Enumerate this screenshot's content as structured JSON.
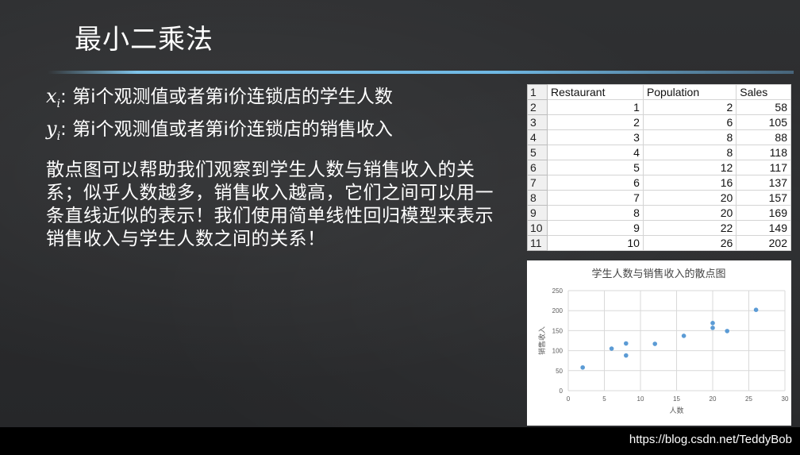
{
  "slide": {
    "title": "最小二乘法",
    "defs": [
      {
        "var": "x",
        "sub": "i",
        "text": ": 第i个观测值或者第i价连锁店的学生人数"
      },
      {
        "var": "y",
        "sub": "i",
        "text": ": 第i个观测值或者第i价连锁店的销售收入"
      }
    ],
    "paragraph": "散点图可以帮助我们观察到学生人数与销售收入的关系；似乎人数越多，销售收入越高，它们之间可以用一条直线近似的表示！我们使用简单线性回归模型来表示销售收入与学生人数之间的关系！",
    "watermark": "https://blog.csdn.net/TeddyBob"
  },
  "table": {
    "row_numbers": [
      "1",
      "2",
      "3",
      "4",
      "5",
      "6",
      "7",
      "8",
      "9",
      "10",
      "11"
    ],
    "headers": [
      "Restaurant",
      "Population",
      "Sales"
    ],
    "rows": [
      [
        "1",
        "2",
        "58"
      ],
      [
        "2",
        "6",
        "105"
      ],
      [
        "3",
        "8",
        "88"
      ],
      [
        "4",
        "8",
        "118"
      ],
      [
        "5",
        "12",
        "117"
      ],
      [
        "6",
        "16",
        "137"
      ],
      [
        "7",
        "20",
        "157"
      ],
      [
        "8",
        "20",
        "169"
      ],
      [
        "9",
        "22",
        "149"
      ],
      [
        "10",
        "26",
        "202"
      ]
    ]
  },
  "chart_data": {
    "type": "scatter",
    "title": "学生人数与销售收入的散点图",
    "xlabel": "人数",
    "ylabel": "销售收入",
    "xlim": [
      0,
      30
    ],
    "ylim": [
      0,
      250
    ],
    "xticks": [
      0,
      5,
      10,
      15,
      20,
      25,
      30
    ],
    "yticks": [
      0,
      50,
      100,
      150,
      200,
      250
    ],
    "grid": true,
    "color": "#5b9bd5",
    "points": [
      [
        2,
        58
      ],
      [
        6,
        105
      ],
      [
        8,
        88
      ],
      [
        8,
        118
      ],
      [
        12,
        117
      ],
      [
        16,
        137
      ],
      [
        20,
        157
      ],
      [
        20,
        169
      ],
      [
        22,
        149
      ],
      [
        26,
        202
      ]
    ]
  }
}
